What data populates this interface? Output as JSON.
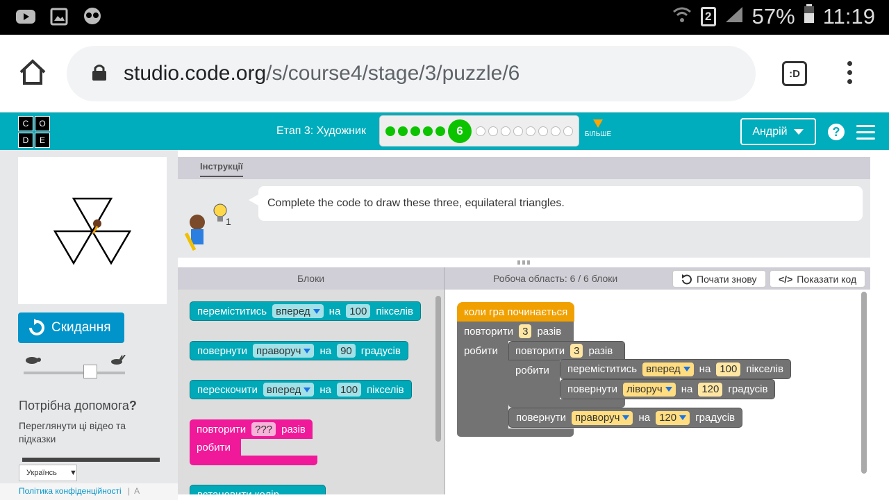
{
  "status": {
    "battery": "57%",
    "time": "11:19",
    "sim": "2"
  },
  "browser": {
    "url_domain": "studio.code.org",
    "url_path": "/s/course4/stage/3/puzzle/6",
    "tab_label": ":D"
  },
  "header": {
    "logo_letters": [
      "C",
      "O",
      "D",
      "E"
    ],
    "stage_title": "Етап 3: Художник",
    "current_level": "6",
    "levels_done": 5,
    "levels_todo": 8,
    "more_label": "БІЛЬШЕ",
    "user_label": "Андрій",
    "help": "?"
  },
  "left": {
    "reset_label": "Скидання",
    "help_title": "Потрібна допомога",
    "help_q": "?",
    "help_sub": "Переглянути ці відео та підказки",
    "language": "Українсь",
    "privacy": "Політика конфіденційності",
    "sep": "|",
    "more_footer": "A"
  },
  "instructions": {
    "tab": "Інструкції",
    "text": "Complete the code to draw these three, equilateral triangles.",
    "hint_count": "1"
  },
  "workspace": {
    "blocks_header": "Блоки",
    "count": "Робоча область: 6 / 6 блоки",
    "reset_button": "Почати знову",
    "show_code": "Показати код"
  },
  "toolbox": {
    "b1": {
      "a": "переміститись",
      "dir": "вперед",
      "b": "на",
      "num": "100",
      "c": "пікселів"
    },
    "b2": {
      "a": "повернути",
      "dir": "праворуч",
      "b": "на",
      "num": "90",
      "c": "градусів"
    },
    "b3": {
      "a": "перескочити",
      "dir": "вперед",
      "b": "на",
      "num": "100",
      "c": "пікселів"
    },
    "b4": {
      "a": "повторити",
      "num": "???",
      "c": "разів",
      "do": "робити"
    },
    "b5": {
      "a": "встановити колір"
    }
  },
  "program": {
    "start": "коли гра починається",
    "r1": {
      "a": "повторити",
      "num": "3",
      "c": "разів",
      "do": "робити"
    },
    "r2": {
      "a": "повторити",
      "num": "3",
      "c": "разів",
      "do": "робити"
    },
    "m1": {
      "a": "переміститись",
      "dir": "вперед",
      "b": "на",
      "num": "100",
      "c": "пікселів"
    },
    "t1": {
      "a": "повернути",
      "dir": "ліворуч",
      "b": "на",
      "num": "120",
      "c": "градусів"
    },
    "t2": {
      "a": "повернути",
      "dir": "праворуч",
      "b": "на",
      "num": "120",
      "c": "градусів"
    }
  },
  "colors": {
    "teal": "#00adbc",
    "green": "#0cc300",
    "orange": "#f0a000",
    "pink": "#f0199a",
    "blue": "#0094ca"
  }
}
